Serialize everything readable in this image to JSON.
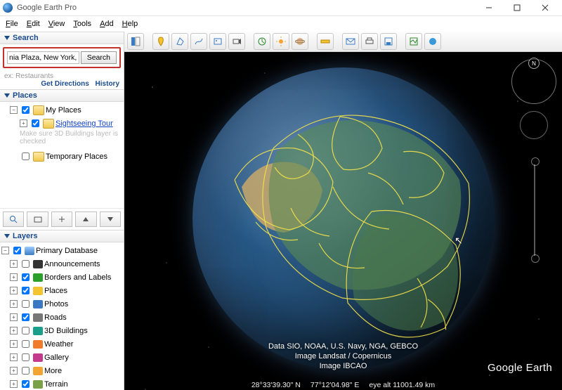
{
  "window": {
    "title": "Google Earth Pro"
  },
  "menu": {
    "file": "File",
    "edit": "Edit",
    "view": "View",
    "tools": "Tools",
    "add": "Add",
    "help": "Help"
  },
  "toolbar_icons": [
    "panel-toggle",
    "placemark",
    "polygon",
    "path",
    "image-overlay",
    "record-tour",
    "historical-imagery",
    "sun",
    "planet",
    "ruler",
    "email",
    "print",
    "save-image",
    "view-in-maps",
    "sign-in"
  ],
  "search": {
    "header": "Search",
    "value": "nia Plaza, New York, NY, USA",
    "button": "Search",
    "hint": "ex: Restaurants",
    "get_directions": "Get Directions",
    "history": "History"
  },
  "places": {
    "header": "Places",
    "my_places": "My Places",
    "tour": "Sightseeing Tour",
    "tour_hint": "Make sure 3D Buildings layer is checked",
    "temp": "Temporary Places"
  },
  "layers": {
    "header": "Layers",
    "primary": "Primary Database",
    "items": [
      {
        "label": "Announcements",
        "checked": false,
        "color": "#333"
      },
      {
        "label": "Borders and Labels",
        "checked": true,
        "color": "#2aa02a"
      },
      {
        "label": "Places",
        "checked": true,
        "color": "#f4c430"
      },
      {
        "label": "Photos",
        "checked": false,
        "color": "#3b78c4"
      },
      {
        "label": "Roads",
        "checked": true,
        "color": "#777"
      },
      {
        "label": "3D Buildings",
        "checked": false,
        "color": "#1aa08a"
      },
      {
        "label": "Weather",
        "checked": false,
        "color": "#f07b2a"
      },
      {
        "label": "Gallery",
        "checked": false,
        "color": "#c43b8e"
      },
      {
        "label": "More",
        "checked": false,
        "color": "#f4a430"
      },
      {
        "label": "Terrain",
        "checked": true,
        "color": "#7aa048"
      }
    ]
  },
  "attribution": {
    "line1": "Data SIO, NOAA, U.S. Navy, NGA, GEBCO",
    "line2": "Image Landsat / Copernicus",
    "line3": "Image IBCAO"
  },
  "logo": "Google Earth",
  "status": {
    "lat": "28°33'39.30\" N",
    "lon": "77°12'04.98\" E",
    "eye": "eye alt 11001.49 km"
  },
  "compass": "N"
}
